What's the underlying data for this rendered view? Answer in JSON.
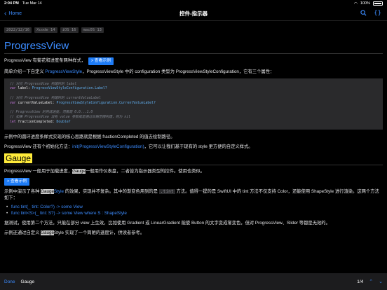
{
  "status": {
    "time": "2:04 PM",
    "date": "Tue Mar 14",
    "battery": "100%"
  },
  "nav": {
    "back_label": "Home",
    "title": "控件-指示器"
  },
  "tags": [
    "2022/12/16",
    "Xcode 14",
    "iOS 16",
    "macOS 13"
  ],
  "progress": {
    "heading": "ProgressView",
    "intro": "ProgressView 有菊花和进度条两种样式，",
    "example_button": "> 查看示例",
    "p1_a": "简单介绍一下自定义 ",
    "p1_link": "ProgressViewStyle",
    "p1_b": "，ProgressViewStyle 中的 configuration 类型为 ProgressViewStyleConfiguration，它有三个属性：",
    "code": [
      {
        "t": "cm",
        "v": "// 对应 ProgressView 构建时的 label"
      },
      {
        "t": "mix",
        "kw": "var",
        "id": " label: ",
        "ty": "ProgressViewStyleConfiguration.Label?"
      },
      {
        "t": "blank",
        "v": ""
      },
      {
        "t": "cm",
        "v": "// 对应 ProgressView 构建时的 currentValueLabel"
      },
      {
        "t": "mix",
        "kw": "var",
        "id": " currentValueLabel: ",
        "ty": "ProgressViewStyleConfiguration.CurrentValueLabel?"
      },
      {
        "t": "blank",
        "v": ""
      },
      {
        "t": "cm",
        "v": "// ProgressView 的完成进度，范围是 0.0...1.0"
      },
      {
        "t": "cm",
        "v": "// 如果 ProgressView 没有 value 参数或是通过日期范围构建，则为 nil"
      },
      {
        "t": "mix",
        "kw": "let",
        "id": " fractionCompleted: ",
        "ty": "Double?"
      }
    ],
    "p2": "示例中的圆环进度条样式实现的核心思路就是根据 fractionCompleted 的值去绘制路径。",
    "p3_a": "ProgressView 还有个初始化方法：",
    "p3_link": "init(ProgressViewStyleConfiguration)",
    "p3_b": "，它可以让我们基于现有的 style 更方便的自定义样式。"
  },
  "gauge": {
    "heading": "Gauge",
    "p1_a": "ProgressView 一般用于加载进度，",
    "p1_hl": "Gauge",
    "p1_b": "一般用作仪表盘，二者皆为指示器类型的控件。使用也类似。",
    "example_button": "> 查看示例",
    "p2_a": "示例中演示了各种 ",
    "p2_hl": "Gauge",
    "p2_link": "Style",
    "p2_b": " 的效果，实现并不复杂。其中的渐变色用到的是 ",
    "p2_code": ".tint",
    "p2_c": " 方法。值得一提的是 SwiftUI 中的 tint 方法不仅支持 Color，还能使用 ShapeStyle 进行渲染。这两个方法如下：",
    "list": [
      "func tint(_ tint: Color?) -> some View",
      "func tint<S>(_ tint: S?) -> some View where S : ShapeStyle"
    ],
    "p3": "据测试，使用第二个方法，只能在部分 view 上生效，比如使用 Gradient 或 LinearGradient 能使 Button 的文字变成渐变色，但对 ProgressView、Slider 等都是无效的。",
    "p4_a": "示例还通过自定义 ",
    "p4_hl": "Gauge",
    "p4_b": "Style 实现了一个简陋的速度计，供读者参考。"
  },
  "findbar": {
    "done_label": "Done",
    "query": "Gauge",
    "count": "1/4"
  },
  "icons": {
    "search": "magnifier-icon",
    "braces": "braces-icon",
    "up": "chevron-up-icon",
    "down": "chevron-down-icon"
  },
  "colors": {
    "accent": "#3c8cff",
    "highlight": "#ffeb3b",
    "background": "#000000"
  }
}
